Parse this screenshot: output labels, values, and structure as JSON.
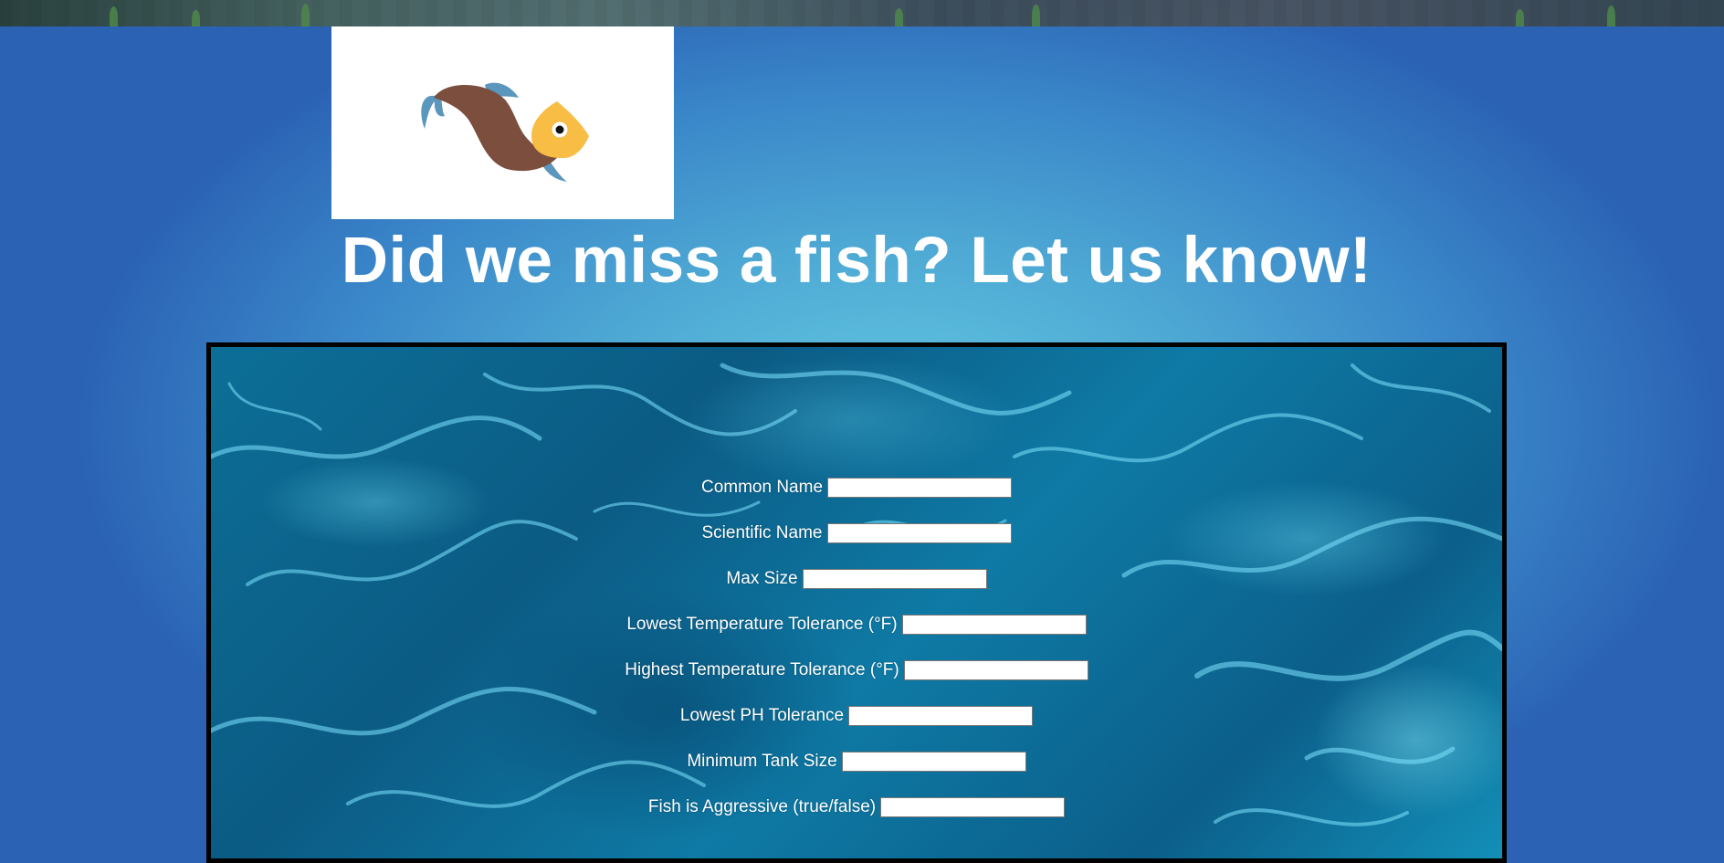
{
  "header": {
    "logo_icon": "fish-logo-icon",
    "title": "Did we miss a fish? Let us know!"
  },
  "form": {
    "fields": [
      {
        "label": "Common Name",
        "value": "",
        "placeholder": ""
      },
      {
        "label": "Scientific Name",
        "value": "",
        "placeholder": ""
      },
      {
        "label": "Max Size",
        "value": "",
        "placeholder": ""
      },
      {
        "label": "Lowest Temperature Tolerance (°F)",
        "value": "",
        "placeholder": ""
      },
      {
        "label": "Highest Temperature Tolerance (°F)",
        "value": "",
        "placeholder": ""
      },
      {
        "label": "Lowest PH Tolerance",
        "value": "",
        "placeholder": ""
      },
      {
        "label": "Minimum Tank Size",
        "value": "",
        "placeholder": ""
      },
      {
        "label": "Fish is Aggressive (true/false)",
        "value": "",
        "placeholder": ""
      }
    ]
  },
  "colors": {
    "background_center": "#63c8e2",
    "background_edge": "#2b62b4",
    "title_text": "#ffffff",
    "panel_border": "#000000",
    "logo_fish_body": "#7b4e3e",
    "logo_fish_head": "#f7bd45",
    "logo_fish_fin": "#5b96bd"
  }
}
